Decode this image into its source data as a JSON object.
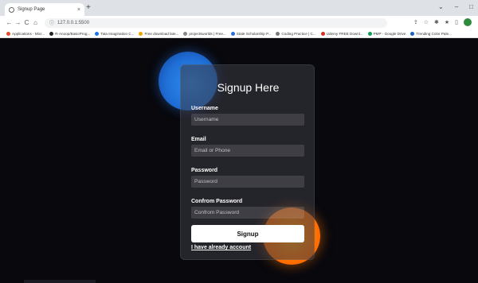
{
  "browser": {
    "tab_title": "Signup Page",
    "tab_close": "×",
    "new_tab": "+",
    "window_controls": [
      "⌄",
      "–",
      "□"
    ],
    "url": "127.0.0.1:5500",
    "nav": {
      "back": "←",
      "forward": "→",
      "reload": "C",
      "home": "⌂"
    },
    "toolbar_icons": [
      "share-icon",
      "star-icon",
      "extensions-icon",
      "pin-icon",
      "sidebar-icon",
      "profile-icon"
    ],
    "bookmarks": [
      {
        "label": "Applications - Micr...",
        "color": "#e34c26"
      },
      {
        "label": "R-Anoop/BasicProg...",
        "color": "#222222"
      },
      {
        "label": "Tata Imagination C...",
        "color": "#1a73e8"
      },
      {
        "label": "Free download late...",
        "color": "#f2a600"
      },
      {
        "label": "projectsworlds | Free...",
        "color": "#888888"
      },
      {
        "label": "State Scholarship P...",
        "color": "#2d6cdf"
      },
      {
        "label": "Coding Practice | C...",
        "color": "#7a7a7a"
      },
      {
        "label": "Udemy FREE Downl...",
        "color": "#d93025"
      },
      {
        "label": "PMP - Google Drive",
        "color": "#0f9d58"
      },
      {
        "label": "Trending Color Pale...",
        "color": "#1565c0"
      }
    ]
  },
  "form": {
    "title": "Signup Here",
    "username_label": "Username",
    "username_placeholder": "Username",
    "email_label": "Email",
    "email_placeholder": "Email or Phone",
    "password_label": "Password",
    "password_placeholder": "Password",
    "confirm_label": "Confrom Password",
    "confirm_placeholder": "Confrom Password",
    "submit_label": "Signup",
    "login_link": "I have already account"
  },
  "colors": {
    "page_bg": "#08080d",
    "orb_blue": "#1f6fd6",
    "orb_orange": "#ff7a00"
  }
}
